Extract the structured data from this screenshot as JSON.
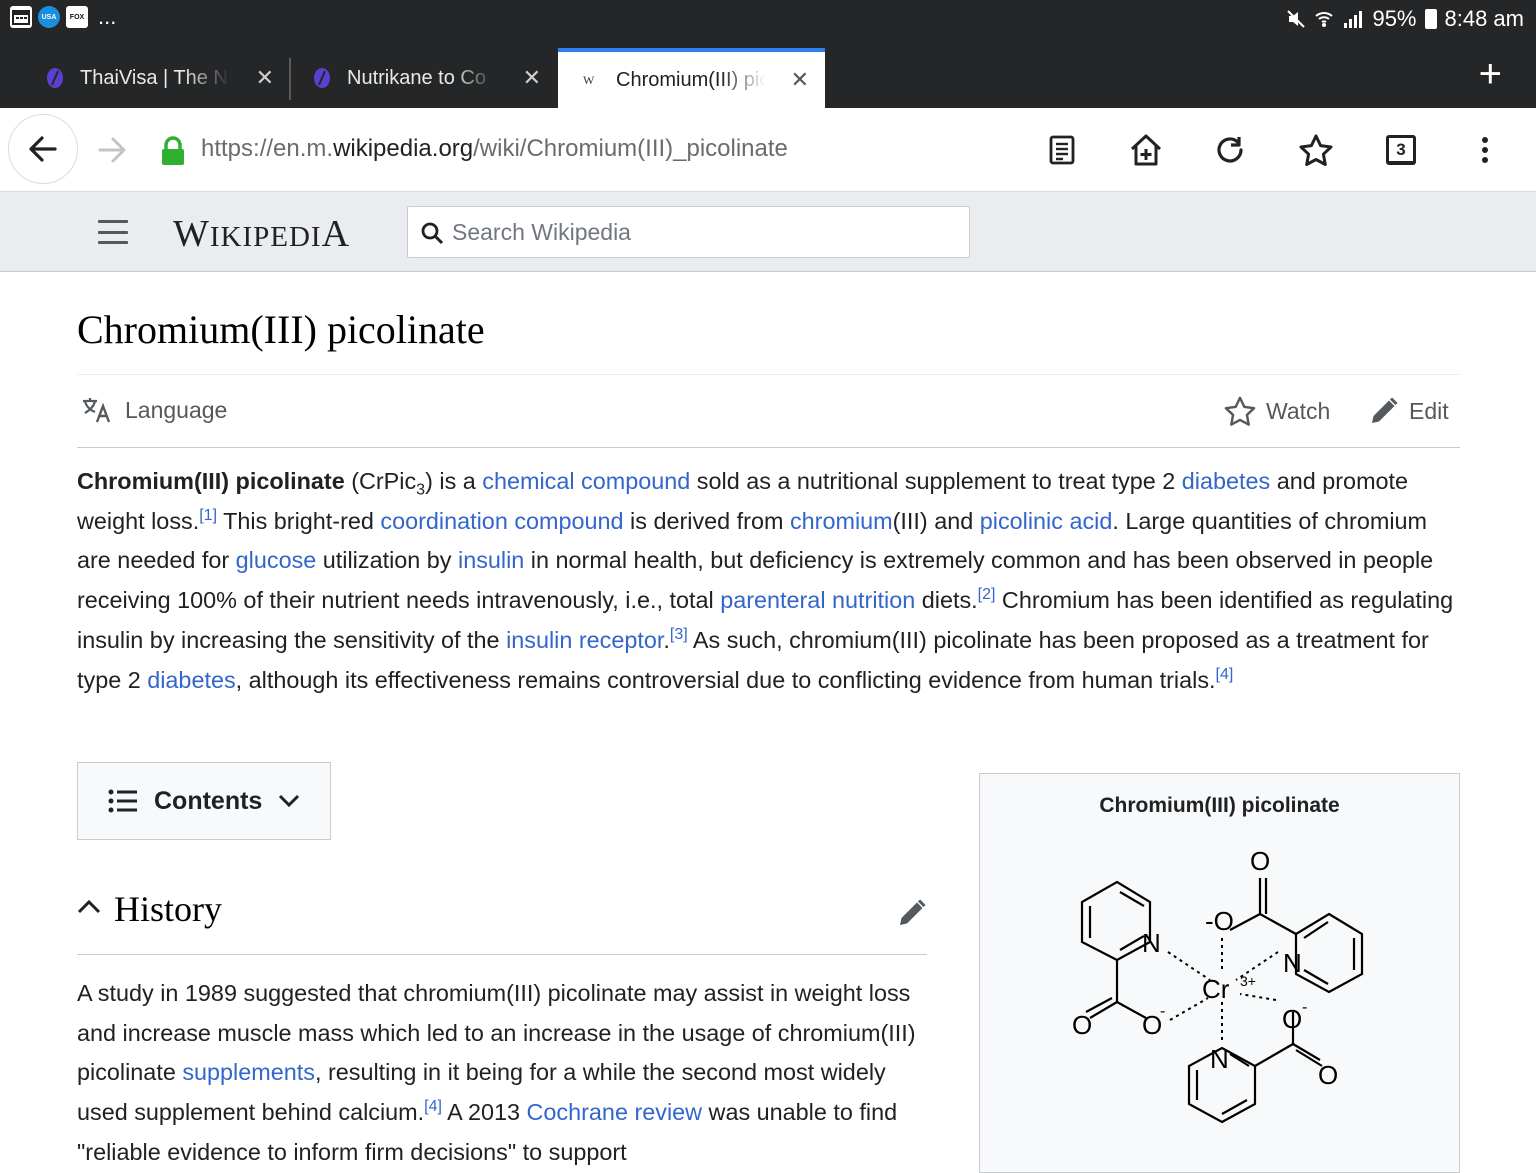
{
  "status": {
    "left_icons": [
      "calendar-icon",
      "usa-today-icon",
      "fox-news-icon"
    ],
    "more": "...",
    "battery": "95%",
    "time": "8:48 am"
  },
  "tabs": [
    {
      "title": "ThaiVisa | The N",
      "icon": "vpn-shield-icon"
    },
    {
      "title": "Nutrikane to Co",
      "icon": "vpn-shield-icon"
    },
    {
      "title": "Chromium(III) pic",
      "icon": "wikipedia-w-icon",
      "active": true
    }
  ],
  "urlbar": {
    "url_prefix": "https://en.m.",
    "url_domain": "wikipedia.org",
    "url_path": "/wiki/Chromium(III)_picolinate",
    "tab_count": "3"
  },
  "wiki": {
    "logo": "Wikipedia",
    "search_placeholder": "Search Wikipedia"
  },
  "article": {
    "title": "Chromium(III) picolinate",
    "language_label": "Language",
    "watch_label": "Watch",
    "edit_label": "Edit",
    "lead": {
      "bold_name": "Chromium(III) picolinate",
      "formula_pre": " (CrPic",
      "formula_sub": "3",
      "t1": ") is a ",
      "l_chemical_compound": "chemical compound",
      "t2": " sold as a nutritional supplement to treat type 2 ",
      "l_diabetes1": "diabetes",
      "t3": " and promote weight loss.",
      "ref1": "[1]",
      "t4": " This bright-red ",
      "l_coordination": "coordination compound",
      "t5": " is derived from ",
      "l_chromium": "chromium",
      "t6": "(III) and ",
      "l_picolinic": "picolinic acid",
      "t7": ". Large quantities of chromium are needed for ",
      "l_glucose": "glucose",
      "t8": " utilization by ",
      "l_insulin": "insulin",
      "t9": " in normal health, but deficiency is extremely common and has been observed in people receiving 100% of their nutrient needs intravenously, i.e., total ",
      "l_parenteral": "parenteral nutrition",
      "t10": " diets.",
      "ref2": "[2]",
      "t11": " Chromium has been identified as regulating insulin by increasing the sensitivity of the ",
      "l_receptor": "insulin receptor",
      "t12": ".",
      "ref3": "[3]",
      "t13": " As such, chromium(III) picolinate has been proposed as a treatment for type 2 ",
      "l_diabetes2": "diabetes",
      "t14": ", although its effectiveness remains controversial due to conflicting evidence from human trials.",
      "ref4": "[4]"
    },
    "toc_label": "Contents",
    "history": {
      "heading": "History",
      "t1": "A study in 1989 suggested that chromium(III) picolinate may assist in weight loss and increase muscle mass which led to an increase in the usage of chromium(III) picolinate ",
      "l_supplements": "supplements",
      "t2": ", resulting in it being for a while the second most widely used supplement behind calcium.",
      "ref4": "[4]",
      "t3": " A 2013 ",
      "l_cochrane": "Cochrane review",
      "t4": " was unable to find \"reliable evidence to inform firm decisions\" to support"
    },
    "infobox": {
      "title": "Chromium(III) picolinate",
      "atoms": {
        "o": "O",
        "o_minus": "-O",
        "o_minus_right": "O",
        "n": "N",
        "cr": "Cr",
        "cr_charge": "3+",
        "minus": "-"
      }
    }
  }
}
